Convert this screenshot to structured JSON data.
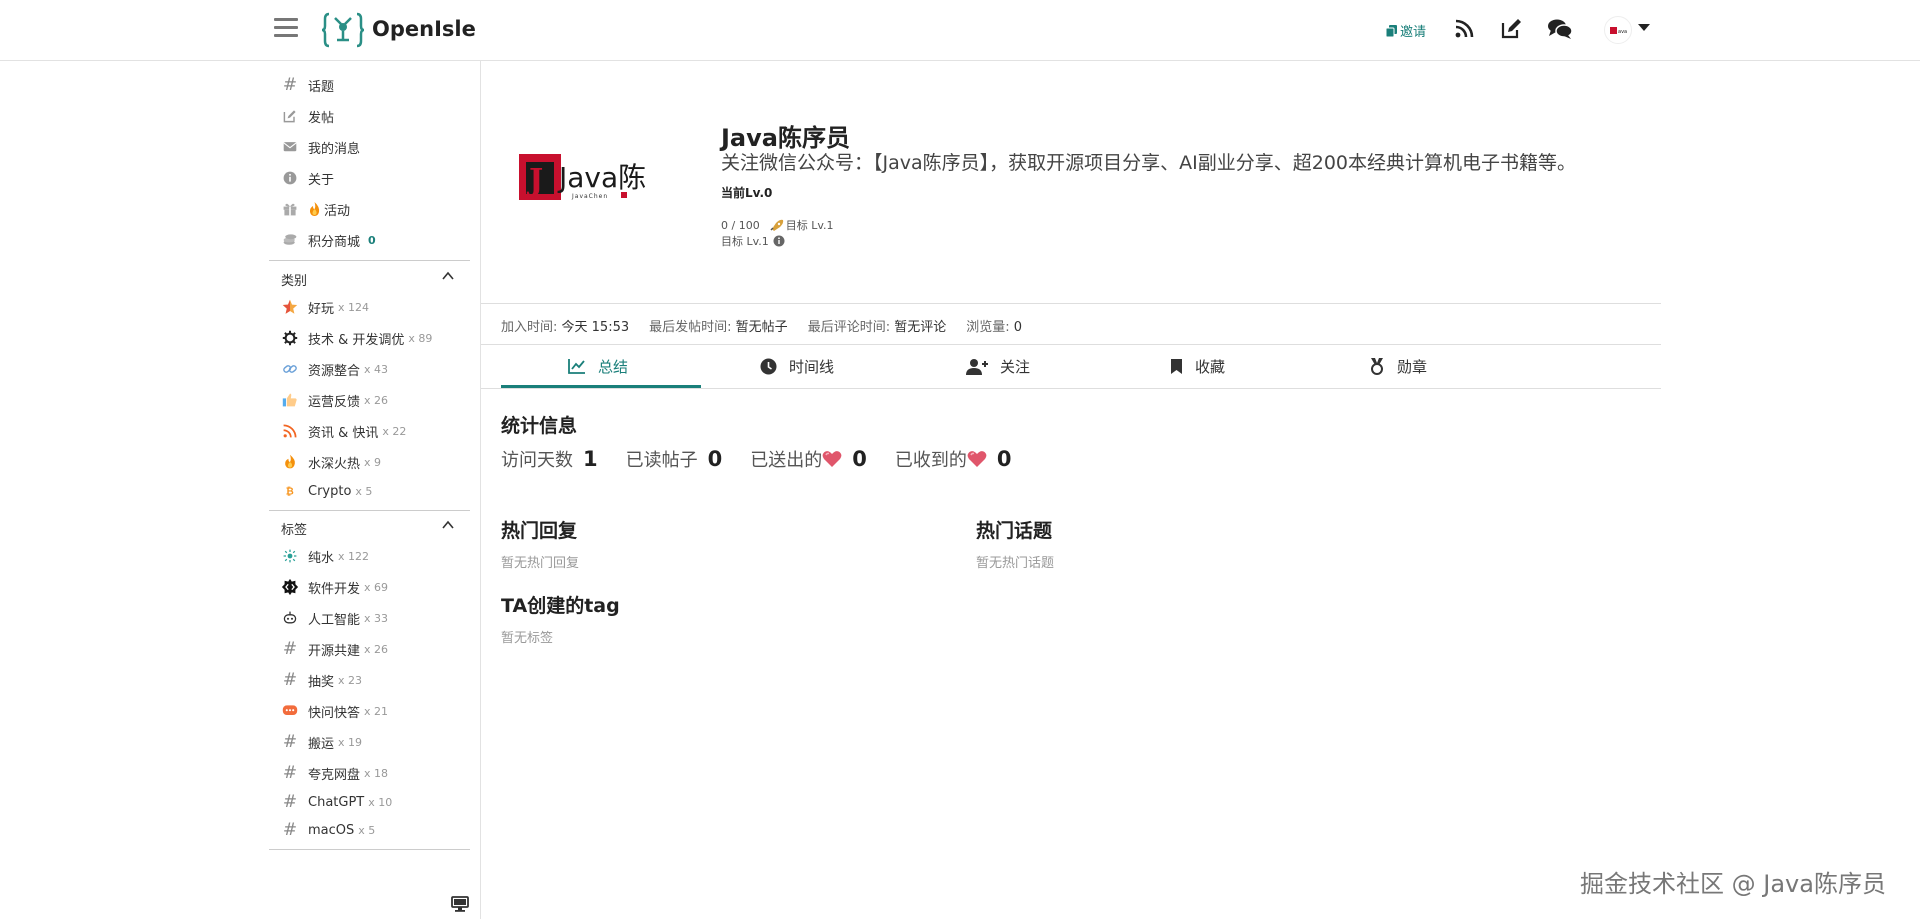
{
  "header": {
    "brand": "OpenIsle",
    "invite_label": "邀请"
  },
  "sidebar": {
    "nav": [
      {
        "label": "话题",
        "icon": "hash-icon"
      },
      {
        "label": "发帖",
        "icon": "edit-icon"
      },
      {
        "label": "我的消息",
        "icon": "mail-icon"
      },
      {
        "label": "关于",
        "icon": "info-icon"
      },
      {
        "label": "活动",
        "icon": "gift-icon"
      },
      {
        "label": "积分商城",
        "icon": "coins-icon",
        "count": "0"
      }
    ],
    "categories_title": "类别",
    "categories": [
      {
        "label": "好玩",
        "count": "x 124"
      },
      {
        "label": "技术 & 开发调优",
        "count": "x 89"
      },
      {
        "label": "资源整合",
        "count": "x 43"
      },
      {
        "label": "运营反馈",
        "count": "x 26"
      },
      {
        "label": "资讯 & 快讯",
        "count": "x 22"
      },
      {
        "label": "水深火热",
        "count": "x 9"
      },
      {
        "label": "Crypto",
        "count": "x 5"
      }
    ],
    "tags_title": "标签",
    "tags": [
      {
        "label": "纯水",
        "count": "x 122"
      },
      {
        "label": "软件开发",
        "count": "x 69"
      },
      {
        "label": "人工智能",
        "count": "x 33"
      },
      {
        "label": "开源共建",
        "count": "x 26"
      },
      {
        "label": "抽奖",
        "count": "x 23"
      },
      {
        "label": "快问快答",
        "count": "x 21"
      },
      {
        "label": "搬运",
        "count": "x 19"
      },
      {
        "label": "夸克网盘",
        "count": "x 18"
      },
      {
        "label": "ChatGPT",
        "count": "x 10"
      },
      {
        "label": "macOS",
        "count": "x 5"
      }
    ]
  },
  "profile": {
    "name": "Java陈序员",
    "bio": "关注微信公众号：【Java陈序员】，获取开源项目分享、AI副业分享、超200本经典计算机电子书籍等。",
    "current_level": "当前Lv.0",
    "exp": "0 / 100",
    "target_level": "目标 Lv.1",
    "target_level_2": "目标 Lv.1",
    "avatar_text": "Java陈",
    "avatar_subtext": "JavaChen"
  },
  "meta": {
    "join_label": "加入时间:",
    "join_value": "今天 15:53",
    "last_post_label": "最后发帖时间:",
    "last_post_value": "暂无帖子",
    "last_comment_label": "最后评论时间:",
    "last_comment_value": "暂无评论",
    "views_label": "浏览量:",
    "views_value": "0"
  },
  "tabs": [
    {
      "label": "总结",
      "icon": "chart-line-icon",
      "active": true
    },
    {
      "label": "时间线",
      "icon": "clock-icon"
    },
    {
      "label": "关注",
      "icon": "user-plus-icon"
    },
    {
      "label": "收藏",
      "icon": "bookmark-icon"
    },
    {
      "label": "勋章",
      "icon": "medal-icon"
    }
  ],
  "stats": {
    "title": "统计信息",
    "visit_days_label": "访问天数",
    "visit_days": "1",
    "read_posts_label": "已读帖子",
    "read_posts": "0",
    "sent_label": "已送出的",
    "sent": "0",
    "received_label": "已收到的",
    "received": "0"
  },
  "sections": {
    "hot_replies_title": "热门回复",
    "hot_replies_empty": "暂无热门回复",
    "hot_topics_title": "热门话题",
    "hot_topics_empty": "暂无热门话题",
    "tags_created_title": "TA创建的tag",
    "tags_created_empty": "暂无标签"
  },
  "watermark": "掘金技术社区 @ Java陈序员",
  "colors": {
    "accent": "#1a7f7a",
    "heart": "#e0566b"
  }
}
